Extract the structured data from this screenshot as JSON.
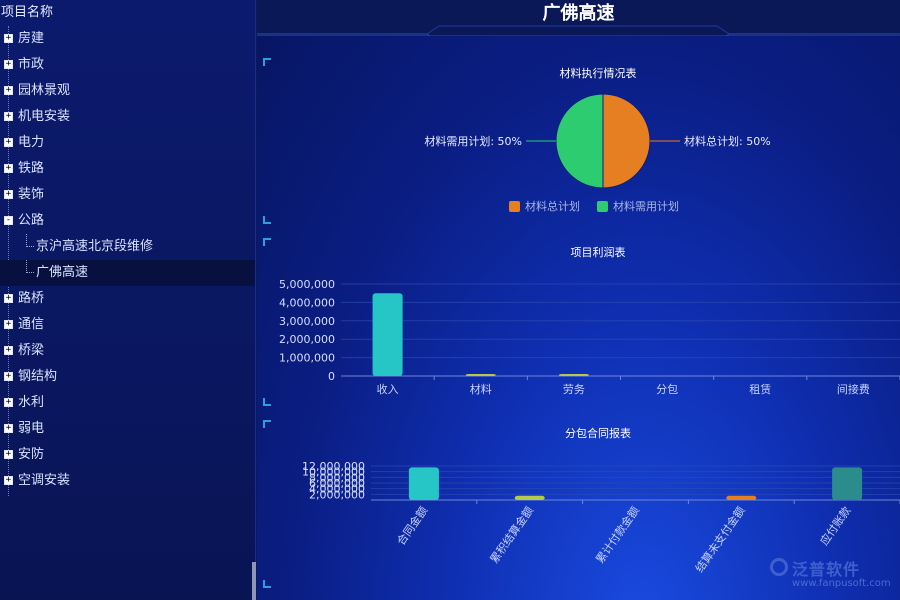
{
  "sidebar": {
    "header": "项目名称",
    "items": [
      {
        "label": "房建",
        "toggle": "+"
      },
      {
        "label": "市政",
        "toggle": "+"
      },
      {
        "label": "园林景观",
        "toggle": "+"
      },
      {
        "label": "机电安装",
        "toggle": "+"
      },
      {
        "label": "电力",
        "toggle": "+"
      },
      {
        "label": "铁路",
        "toggle": "+"
      },
      {
        "label": "装饰",
        "toggle": "+"
      },
      {
        "label": "公路",
        "toggle": "-"
      },
      {
        "label": "京沪高速北京段维修",
        "child": true
      },
      {
        "label": "广佛高速",
        "child": true,
        "selected": true
      },
      {
        "label": "路桥",
        "toggle": "+"
      },
      {
        "label": "通信",
        "toggle": "+"
      },
      {
        "label": "桥梁",
        "toggle": "+"
      },
      {
        "label": "钢结构",
        "toggle": "+"
      },
      {
        "label": "水利",
        "toggle": "+"
      },
      {
        "label": "弱电",
        "toggle": "+"
      },
      {
        "label": "安防",
        "toggle": "+"
      },
      {
        "label": "空调安装",
        "toggle": "+"
      }
    ]
  },
  "main": {
    "title": "广佛高速"
  },
  "colors": {
    "orange": "#e67e22",
    "green": "#2ecc71",
    "teal": "#26c6c6",
    "darkteal": "#2a8c8c",
    "lime": "#b5c94a"
  },
  "watermark": {
    "name": "泛普软件",
    "url": "www.fanpusoft.com"
  },
  "chart_data": [
    {
      "type": "pie",
      "title": "材料执行情况表",
      "slices": [
        {
          "name": "材料总计划",
          "value": 50,
          "label": "材料总计划: 50%",
          "color": "#e67e22"
        },
        {
          "name": "材料需用计划",
          "value": 50,
          "label": "材料需用计划: 50%",
          "color": "#2ecc71"
        }
      ],
      "legend": "bottom"
    },
    {
      "type": "bar",
      "title": "项目利润表",
      "categories": [
        "收入",
        "材料",
        "劳务",
        "分包",
        "租赁",
        "间接费"
      ],
      "values": [
        4500000,
        20000,
        40000,
        0,
        0,
        0
      ],
      "colors": [
        "#26c6c6",
        "#b5c94a",
        "#b5c94a",
        "#26c6c6",
        "#26c6c6",
        "#26c6c6"
      ],
      "yticks": [
        "0",
        "1,000,000",
        "2,000,000",
        "3,000,000",
        "4,000,000",
        "5,000,000"
      ],
      "ylim": [
        0,
        5000000
      ]
    },
    {
      "type": "bar",
      "title": "分包合同报表",
      "categories": [
        "合同金额",
        "累积结算金额",
        "累计付款金额",
        "结算未支付金额",
        "应付账款"
      ],
      "values": [
        11500000,
        1500000,
        0,
        1500000,
        11500000
      ],
      "colors": [
        "#26c6c6",
        "#b5c94a",
        "#26c6c6",
        "#e67e22",
        "#2a8c8c"
      ],
      "yticks": [
        "2,000,000",
        "4,000,000",
        "6,000,000",
        "8,000,000",
        "10,000,000",
        "12,000,000"
      ],
      "ylim": [
        0,
        12000000
      ]
    }
  ]
}
